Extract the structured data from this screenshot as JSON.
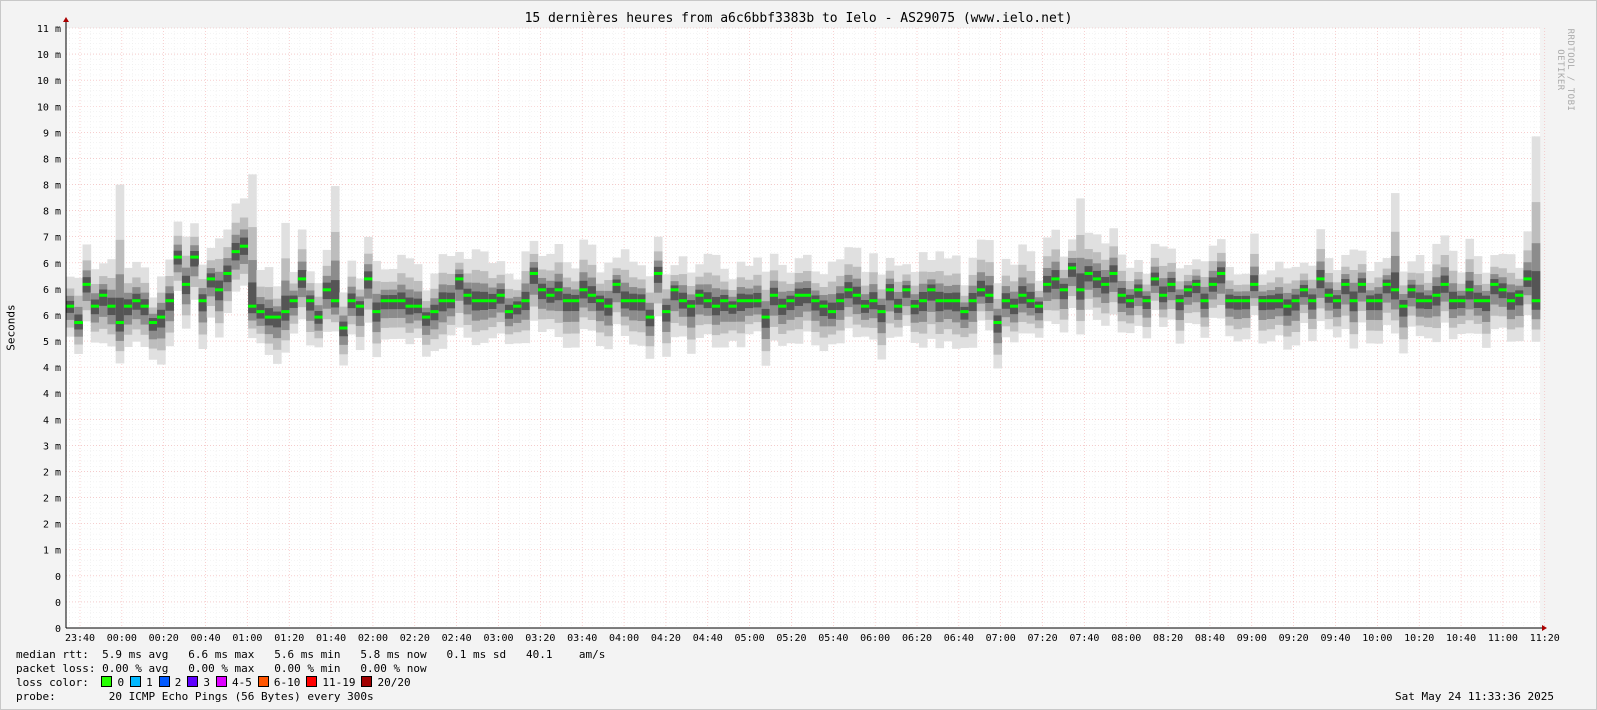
{
  "chart_data": {
    "type": "area",
    "title": "15 dernières heures from a6c6bbf3383b to Ielo - AS29075 (www.ielo.net)",
    "ylabel": "Seconds",
    "watermark": "RRDTOOL / TOBI OETIKER",
    "ylim": [
      0,
      11
    ],
    "y_tick_labels": [
      "0",
      "0",
      "0",
      "1 m",
      "2 m",
      "2 m",
      "2 m",
      "3 m",
      "4 m",
      "4 m",
      "4 m",
      "5 m",
      "6 m",
      "6 m",
      "6 m",
      "7 m",
      "8 m",
      "8 m",
      "8 m",
      "9 m",
      "10 m",
      "10 m",
      "10 m",
      "11 m"
    ],
    "x_tick_labels": [
      "23:40",
      "00:00",
      "00:20",
      "00:40",
      "01:00",
      "01:20",
      "01:40",
      "02:00",
      "02:20",
      "02:40",
      "03:00",
      "03:20",
      "03:40",
      "04:00",
      "04:20",
      "04:40",
      "05:00",
      "05:20",
      "05:40",
      "06:00",
      "06:20",
      "06:40",
      "07:00",
      "07:20",
      "07:40",
      "08:00",
      "08:20",
      "08:40",
      "09:00",
      "09:20",
      "09:40",
      "10:00",
      "10:20",
      "10:40",
      "11:00",
      "11:20"
    ],
    "grid": true,
    "median_rtt_ms": [
      5.9,
      5.6,
      6.3,
      5.9,
      6.1,
      5.9,
      5.6,
      5.9,
      6.0,
      5.9,
      5.6,
      5.7,
      6.0,
      6.8,
      6.3,
      6.8,
      6.0,
      6.4,
      6.2,
      6.5,
      6.9,
      7.0,
      5.9,
      5.8,
      5.7,
      5.7,
      5.8,
      6.0,
      6.4,
      6.0,
      5.7,
      6.2,
      6.0,
      5.5,
      6.0,
      5.9,
      6.4,
      5.8,
      6.0,
      6.0,
      6.0,
      5.9,
      5.9,
      5.7,
      5.8,
      6.0,
      6.0,
      6.4,
      6.1,
      6.0,
      6.0,
      6.0,
      6.1,
      5.8,
      5.9,
      6.0,
      6.5,
      6.2,
      6.1,
      6.2,
      6.0,
      6.0,
      6.2,
      6.1,
      6.0,
      5.9,
      6.3,
      6.0,
      6.0,
      6.0,
      5.7,
      6.5,
      5.8,
      6.2,
      6.0,
      5.9,
      6.1,
      6.0,
      5.9,
      6.0,
      5.9,
      6.0,
      6.0,
      6.0,
      5.7,
      6.1,
      5.9,
      6.0,
      6.1,
      6.1,
      6.0,
      5.9,
      5.8,
      6.0,
      6.2,
      6.1,
      5.9,
      6.0,
      5.8,
      6.2,
      5.9,
      6.2,
      5.9,
      6.0,
      6.2,
      6.0,
      6.0,
      6.0,
      5.8,
      6.0,
      6.2,
      6.1,
      5.6,
      6.0,
      5.9,
      6.1,
      6.0,
      5.9,
      6.3,
      6.4,
      6.2,
      6.6,
      6.2,
      6.5,
      6.4,
      6.3,
      6.5,
      6.1,
      6.0,
      6.2,
      6.0,
      6.4,
      6.1,
      6.3,
      6.0,
      6.2,
      6.3,
      6.0,
      6.3,
      6.5,
      6.0,
      6.0,
      6.0,
      6.3,
      6.0,
      6.0,
      6.0,
      5.9,
      6.0,
      6.2,
      6.0,
      6.4,
      6.1,
      6.0,
      6.3,
      6.0,
      6.3,
      6.0,
      6.0,
      6.3,
      6.2,
      5.9,
      6.2,
      6.0,
      6.0,
      6.1,
      6.3,
      6.0,
      6.0,
      6.2,
      6.0,
      6.0,
      6.3,
      6.2,
      6.0,
      6.1,
      6.4,
      6.0
    ],
    "series": [
      {
        "name": "median rtt",
        "color": "#00ff00"
      },
      {
        "name": "ping spread",
        "color": "#505050"
      }
    ]
  },
  "legend": {
    "median_label": "median rtt:",
    "median_values": "5.9 ms avg   6.6 ms max   5.6 ms min   5.8 ms now   0.1 ms sd   40.1    am/s",
    "loss_label": "packet loss:",
    "loss_values": "0.00 % avg   0.00 % max   0.00 % min   0.00 % now",
    "color_label": "loss color:",
    "loss_colors": [
      {
        "label": "0",
        "color": "#26ff00"
      },
      {
        "label": "1",
        "color": "#00b8ff"
      },
      {
        "label": "2",
        "color": "#0059ff"
      },
      {
        "label": "3",
        "color": "#5e00ff"
      },
      {
        "label": "4-5",
        "color": "#dd00ff"
      },
      {
        "label": "6-10",
        "color": "#ff5500"
      },
      {
        "label": "11-19",
        "color": "#ff0000"
      },
      {
        "label": "20/20",
        "color": "#a10000"
      }
    ],
    "probe_label": "probe:",
    "probe_value": "20 ICMP Echo Pings (56 Bytes) every 300s",
    "timestamp": "Sat May 24 11:33:36 2025"
  }
}
